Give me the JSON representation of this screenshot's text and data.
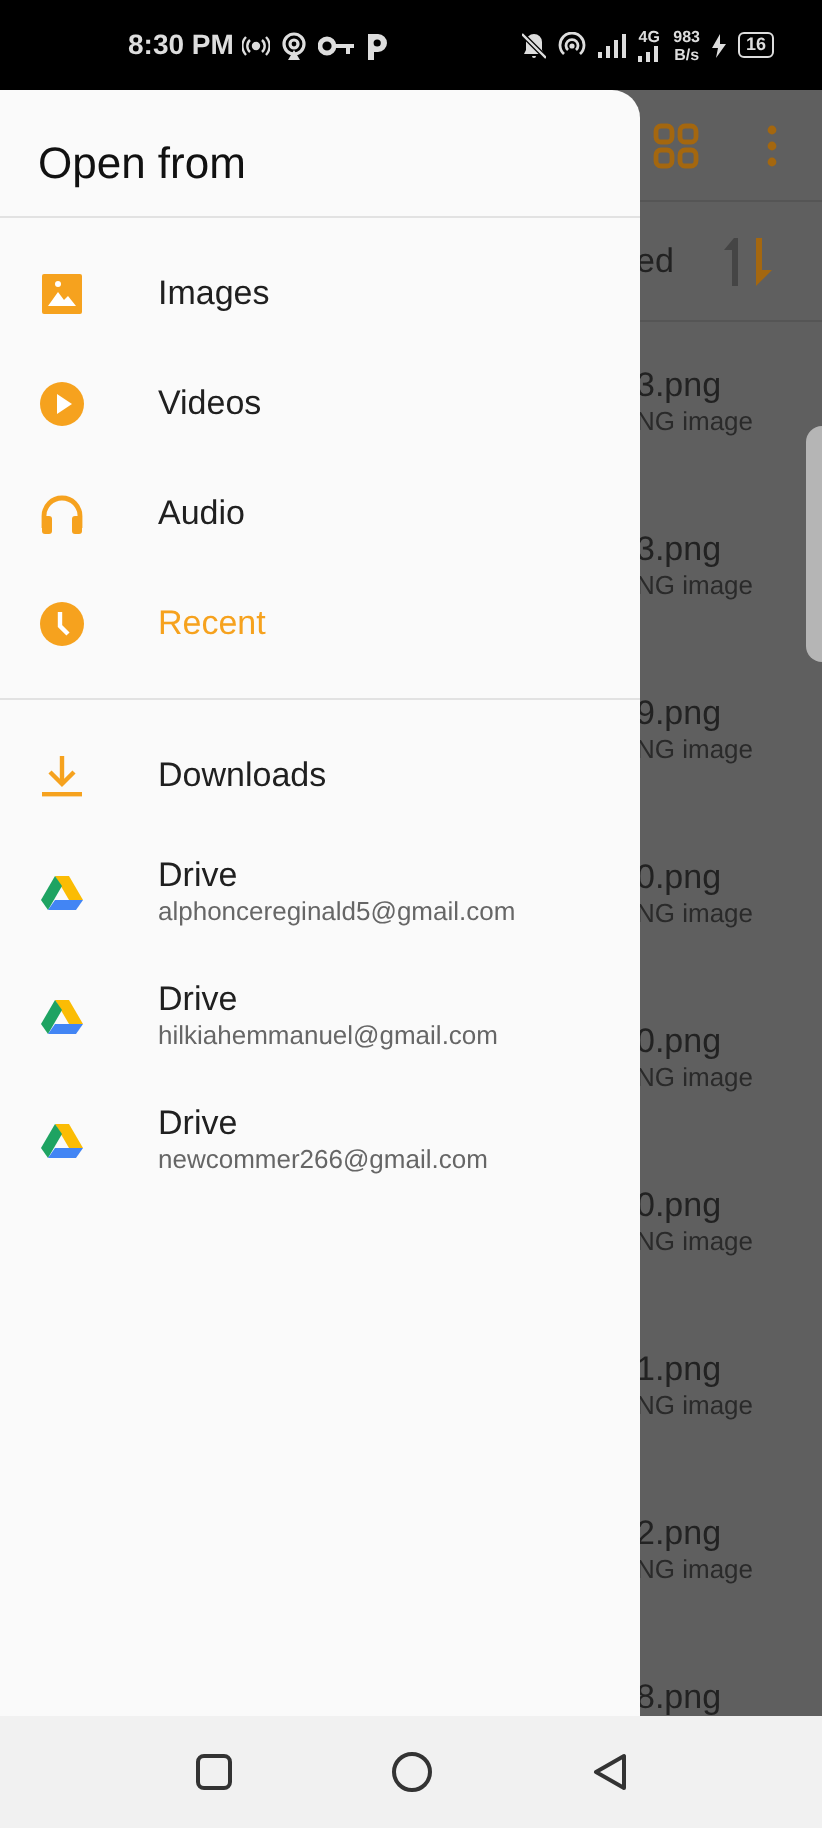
{
  "status_bar": {
    "time": "8:30 PM",
    "network": "4G",
    "speed_value": "983",
    "speed_unit": "B/s",
    "battery": "16"
  },
  "background": {
    "sort_label": "ed",
    "files": [
      {
        "name": "3.png",
        "type": "NG image"
      },
      {
        "name": "3.png",
        "type": "NG image"
      },
      {
        "name": "9.png",
        "type": "NG image"
      },
      {
        "name": "0.png",
        "type": "NG image"
      },
      {
        "name": "0.png",
        "type": "NG image"
      },
      {
        "name": "0.png",
        "type": "NG image"
      },
      {
        "name": "1.png",
        "type": "NG image"
      },
      {
        "name": "2.png",
        "type": "NG image"
      },
      {
        "name": "8.png"
      }
    ]
  },
  "drawer": {
    "title": "Open from",
    "sections": [
      {
        "items": [
          {
            "kind": "images",
            "label": "Images",
            "selected": false
          },
          {
            "kind": "videos",
            "label": "Videos",
            "selected": false
          },
          {
            "kind": "audio",
            "label": "Audio",
            "selected": false
          },
          {
            "kind": "recent",
            "label": "Recent",
            "selected": true
          }
        ]
      },
      {
        "items": [
          {
            "kind": "downloads",
            "label": "Downloads",
            "selected": false
          },
          {
            "kind": "drive",
            "label": "Drive",
            "subtitle": "alphoncereginald5@gmail.com",
            "selected": false
          },
          {
            "kind": "drive",
            "label": "Drive",
            "subtitle": "hilkiahemmanuel@gmail.com",
            "selected": false
          },
          {
            "kind": "drive",
            "label": "Drive",
            "subtitle": "newcommer266@gmail.com",
            "selected": false
          }
        ]
      }
    ]
  }
}
